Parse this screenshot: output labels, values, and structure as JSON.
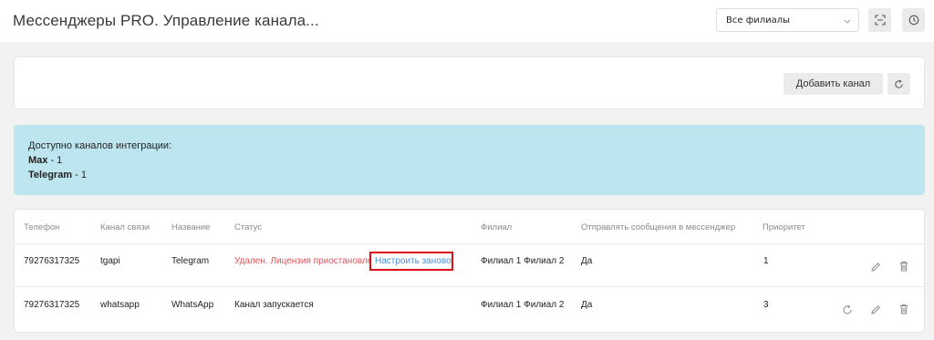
{
  "header": {
    "title": "Мессенджеры PRO. Управление канала...",
    "branch_select_value": "Все филиалы"
  },
  "toolbar": {
    "add_channel_label": "Добавить канал"
  },
  "info": {
    "heading": "Доступно каналов интеграции:",
    "items": [
      {
        "name": "Max",
        "count": " - 1"
      },
      {
        "name": "Telegram",
        "count": " - 1"
      }
    ]
  },
  "table": {
    "columns": [
      "Телефон",
      "Канал связи",
      "Название",
      "Статус",
      "Филиал",
      "Отправлять сообщения в мессенджер",
      "Приоритет"
    ],
    "rows": [
      {
        "phone": "79276317325",
        "channel": "tgapi",
        "name": "Telegram",
        "status": "Удален. Лицензия приостановлена.",
        "status_link": "Настроить заново",
        "branch": "Филиал 1 Филиал 2",
        "send": "Да",
        "priority": "1"
      },
      {
        "phone": "79276317325",
        "channel": "whatsapp",
        "name": "WhatsApp",
        "status": "Канал запускается",
        "branch": "Филиал 1 Филиал 2",
        "send": "Да",
        "priority": "3"
      }
    ]
  },
  "colors": {
    "info_bg": "#bde5ef",
    "status_error": "#e0525a",
    "link": "#4a8fd8",
    "highlight_border": "#d8101a"
  },
  "icons": [
    "chevron-down-icon",
    "fullscreen-icon",
    "history-icon",
    "refresh-icon",
    "edit-icon",
    "trash-icon"
  ]
}
